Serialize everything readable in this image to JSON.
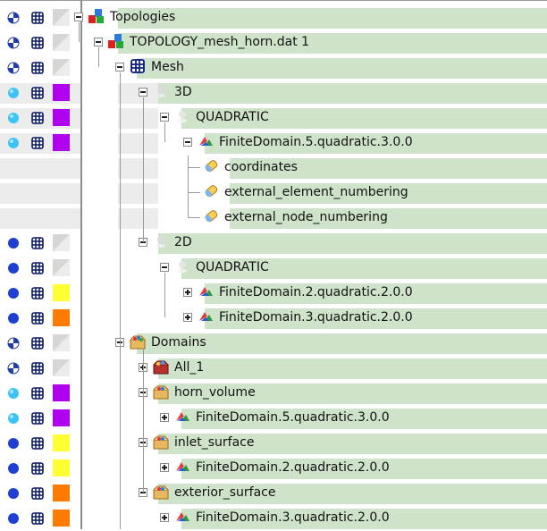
{
  "tree": [
    {
      "label": "Topologies",
      "depth": 0,
      "icon": "topology-icon",
      "toggle": "minus",
      "visibility": "half-icon",
      "color": "#d8d8d8",
      "color_icon": "gray-swatch"
    },
    {
      "label": "TOPOLOGY_mesh_horn.dat 1",
      "depth": 1,
      "icon": "topology-icon",
      "toggle": "minus",
      "visibility": "half-icon",
      "color": "#d8d8d8",
      "color_icon": "gray-swatch"
    },
    {
      "label": "Mesh",
      "depth": 2,
      "icon": "mesh-icon",
      "toggle": "minus",
      "visibility": "half-icon",
      "color": "#d8d8d8",
      "color_icon": "gray-swatch"
    },
    {
      "label": "3D",
      "depth": 3,
      "icon": "dimension-icon",
      "toggle": "minus",
      "visibility": "light-icon",
      "color": "#b000f0",
      "color_icon": "purple-swatch"
    },
    {
      "label": "QUADRATIC",
      "depth": 4,
      "icon": "order-icon",
      "toggle": "minus",
      "visibility": "light-icon",
      "color": "#b000f0",
      "color_icon": "purple-swatch"
    },
    {
      "label": "FiniteDomain.5.quadratic.3.0.0",
      "depth": 5,
      "icon": "finite-domain-icon",
      "toggle": "minus",
      "visibility": "light-icon",
      "color": "#b000f0",
      "color_icon": "purple-swatch"
    },
    {
      "label": "coordinates",
      "depth": 6,
      "icon": "attribute-icon",
      "toggle": null,
      "visibility": null,
      "color": null,
      "color_icon": null
    },
    {
      "label": "external_element_numbering",
      "depth": 6,
      "icon": "attribute-icon",
      "toggle": null,
      "visibility": null,
      "color": null,
      "color_icon": null
    },
    {
      "label": "external_node_numbering",
      "depth": 6,
      "icon": "attribute-icon",
      "toggle": null,
      "visibility": null,
      "color": null,
      "color_icon": null
    },
    {
      "label": "2D",
      "depth": 3,
      "icon": "dimension-icon",
      "toggle": "minus",
      "visibility": "solid-icon",
      "color": "#d8d8d8",
      "color_icon": "gray-swatch"
    },
    {
      "label": "QUADRATIC",
      "depth": 4,
      "icon": "order-icon",
      "toggle": "minus",
      "visibility": "solid-icon",
      "color": "#d8d8d8",
      "color_icon": "gray-swatch"
    },
    {
      "label": "FiniteDomain.2.quadratic.2.0.0",
      "depth": 5,
      "icon": "finite-domain-icon",
      "toggle": "plus",
      "visibility": "solid-icon",
      "color": "#ffff33",
      "color_icon": "yellow-swatch"
    },
    {
      "label": "FiniteDomain.3.quadratic.2.0.0",
      "depth": 5,
      "icon": "finite-domain-icon",
      "toggle": "plus",
      "visibility": "solid-icon",
      "color": "#ff7a00",
      "color_icon": "orange-swatch"
    },
    {
      "label": "Domains",
      "depth": 2,
      "icon": "domains-icon",
      "toggle": "minus",
      "visibility": "half-icon",
      "color": "#d8d8d8",
      "color_icon": "gray-swatch"
    },
    {
      "label": "All_1",
      "depth": 3,
      "icon": "domain-all-icon",
      "toggle": "plus",
      "visibility": "half-icon",
      "color": "#d8d8d8",
      "color_icon": "gray-swatch"
    },
    {
      "label": "horn_volume",
      "depth": 3,
      "icon": "domain-icon",
      "toggle": "minus",
      "visibility": "light-icon",
      "color": "#b000f0",
      "color_icon": "purple-swatch"
    },
    {
      "label": "FiniteDomain.5.quadratic.3.0.0",
      "depth": 4,
      "icon": "finite-domain-icon",
      "toggle": "plus",
      "visibility": "light-icon",
      "color": "#b000f0",
      "color_icon": "purple-swatch"
    },
    {
      "label": "inlet_surface",
      "depth": 3,
      "icon": "domain-icon",
      "toggle": "minus",
      "visibility": "solid-icon",
      "color": "#ffff33",
      "color_icon": "yellow-swatch"
    },
    {
      "label": "FiniteDomain.2.quadratic.2.0.0",
      "depth": 4,
      "icon": "finite-domain-icon",
      "toggle": "plus",
      "visibility": "solid-icon",
      "color": "#ffff33",
      "color_icon": "yellow-swatch"
    },
    {
      "label": "exterior_surface",
      "depth": 3,
      "icon": "domain-icon",
      "toggle": "minus",
      "visibility": "solid-icon",
      "color": "#ff7a00",
      "color_icon": "orange-swatch"
    },
    {
      "label": "FiniteDomain.3.quadratic.2.0.0",
      "depth": 4,
      "icon": "finite-domain-icon",
      "toggle": "plus",
      "visibility": "solid-icon",
      "color": "#ff7a00",
      "color_icon": "orange-swatch"
    }
  ],
  "colors": {
    "selection": "#cfe3ca",
    "grid_line": "#9a9a9a",
    "eye_blue": "#1f3fd0",
    "eye_light": "#3dc3f5"
  }
}
